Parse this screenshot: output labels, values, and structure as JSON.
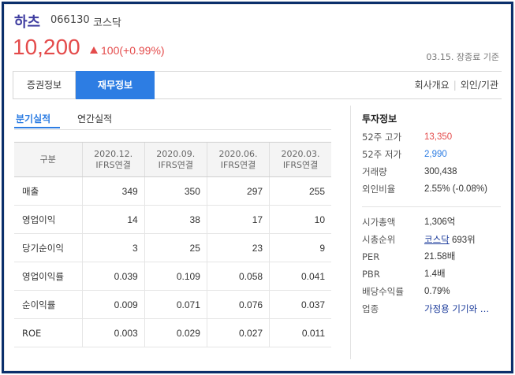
{
  "stock": {
    "name": "하츠",
    "code": "066130",
    "market": "코스닥",
    "price": "10,200",
    "change": "100(+0.99%)",
    "as_of": "03.15. 장종료 기준"
  },
  "tabs": {
    "stock_info": "증권정보",
    "financial_info": "재무정보",
    "company_overview": "회사개요",
    "foreign_institution": "외인/기관"
  },
  "subtabs": {
    "quarterly": "분기실적",
    "annual": "연간실적"
  },
  "table": {
    "headers": [
      {
        "label": "구분",
        "line2": ""
      },
      {
        "label": "2020.12.",
        "line2": "IFRS연결"
      },
      {
        "label": "2020.09.",
        "line2": "IFRS연결"
      },
      {
        "label": "2020.06.",
        "line2": "IFRS연결"
      },
      {
        "label": "2020.03.",
        "line2": "IFRS연결"
      }
    ],
    "rows": [
      {
        "label": "매출",
        "values": [
          "349",
          "350",
          "297",
          "255"
        ]
      },
      {
        "label": "영업이익",
        "values": [
          "14",
          "38",
          "17",
          "10"
        ]
      },
      {
        "label": "당기순이익",
        "values": [
          "3",
          "25",
          "23",
          "9"
        ]
      },
      {
        "label": "영업이익률",
        "values": [
          "0.039",
          "0.109",
          "0.058",
          "0.041"
        ]
      },
      {
        "label": "순이익률",
        "values": [
          "0.009",
          "0.071",
          "0.076",
          "0.037"
        ]
      },
      {
        "label": "ROE",
        "values": [
          "0.003",
          "0.029",
          "0.027",
          "0.011"
        ]
      }
    ]
  },
  "panel": {
    "title": "투자정보",
    "high52_label": "52주 고가",
    "high52": "13,350",
    "low52_label": "52주 저가",
    "low52": "2,990",
    "volume_label": "거래량",
    "volume": "300,438",
    "foreign_label": "외인비율",
    "foreign": "2.55% (-0.08%)",
    "mcap_label": "시가총액",
    "mcap": "1,306억",
    "rank_label": "시총순위",
    "rank_market": "코스닥",
    "rank_value": "693위",
    "per_label": "PER",
    "per": "21.58배",
    "pbr_label": "PBR",
    "pbr": "1.4배",
    "div_label": "배당수익률",
    "div": "0.79%",
    "industry_label": "업종",
    "industry": "가정용 기기와 …"
  },
  "colors": {
    "accent_blue": "#2d7de3",
    "up_red": "#e44b4b",
    "frame_navy": "#0b2f6b",
    "brand_purple": "#3f3da0"
  }
}
